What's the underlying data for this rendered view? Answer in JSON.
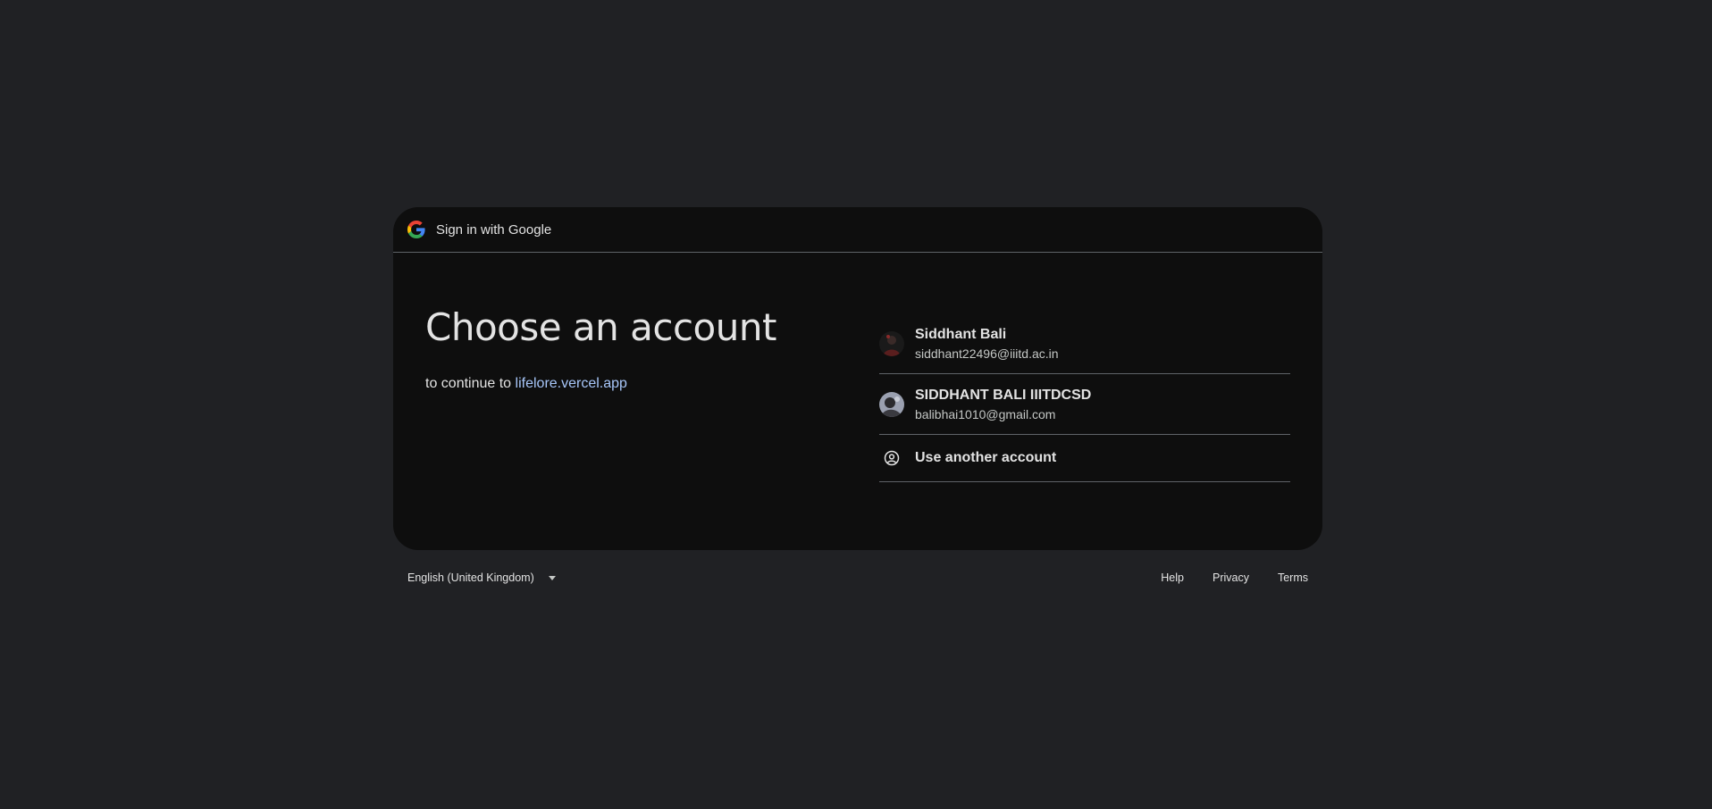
{
  "header": {
    "title": "Sign in with Google",
    "logo_icon": "google-g-icon"
  },
  "main": {
    "heading": "Choose an account",
    "subtitle_prefix": "to continue to",
    "app_name": "lifelore.vercel.app"
  },
  "accounts": [
    {
      "name": "Siddhant Bali",
      "email": "siddhant22496@iiitd.ac.in"
    },
    {
      "name": "SIDDHANT BALI IIITDCSD",
      "email": "balibhai1010@gmail.com"
    }
  ],
  "use_another": {
    "label": "Use another account",
    "icon": "account-circle-icon"
  },
  "footer": {
    "language": "English (United Kingdom)",
    "links": [
      "Help",
      "Privacy",
      "Terms"
    ]
  },
  "colors": {
    "background": "#202124",
    "card": "#0e0e0e",
    "link": "#a8c7fa",
    "divider": "#5f6368"
  }
}
